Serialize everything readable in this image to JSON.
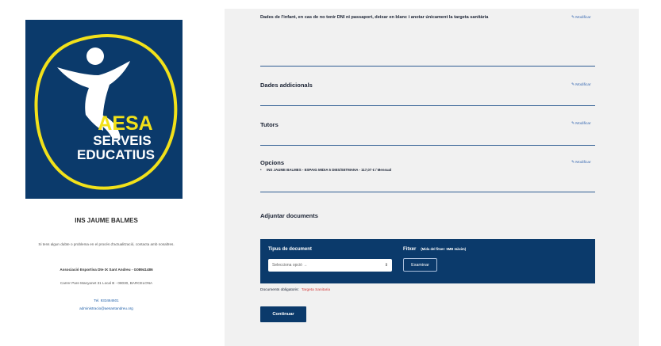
{
  "sidebar": {
    "logo": {
      "line1": "AESA",
      "line2": "SERVEIS",
      "line3": "EDUCATIUS",
      "bg_color": "#0b3a6b",
      "accent_color": "#f2e11a"
    },
    "school_name": "INS JAUME BALMES",
    "help_text": "Si tens algun dubte o problema en el procés d'actualització, contacta amb nosaltres.",
    "association": "Associació Esportiva Dte IX Sant Andreu - G08941486",
    "address": "Carrer Pare Manyanet 31 Local B - 08030, BARCELONA",
    "phone": "Tel. 933464601",
    "email": "administracio@aesantandreu.org"
  },
  "form": {
    "child_data_title": "Dades de l'infant, en cas de no tenir DNI ni passaport, deixar en blanc i anotar únicament la targeta sanitària",
    "modify_label": "Modificar",
    "additional_data_title": "Dades addicionals",
    "tutors_title": "Tutors",
    "options_title": "Opcions",
    "option_item": "INS JAUME BALMES - ESPAIG MIDIA 5 DIES/SETMANA - 117,07 € / Mensual",
    "attach_title": "Adjuntar documents",
    "doc_type_label": "Tipus de document",
    "file_label": "Fitxer",
    "file_hint": "(Mida del fitxer: 5MB màxim)",
    "select_placeholder": "Selecciona opció →",
    "browse_label": "Examinar",
    "required_docs_label": "Documents obligatoris:",
    "required_doc": "Targeta Sanitaria",
    "continue_label": "Continuar"
  },
  "colors": {
    "primary": "#0b3a6b",
    "link": "#3b6bb3",
    "required": "#d23a3a",
    "panel_bg": "#f1f1f1"
  }
}
